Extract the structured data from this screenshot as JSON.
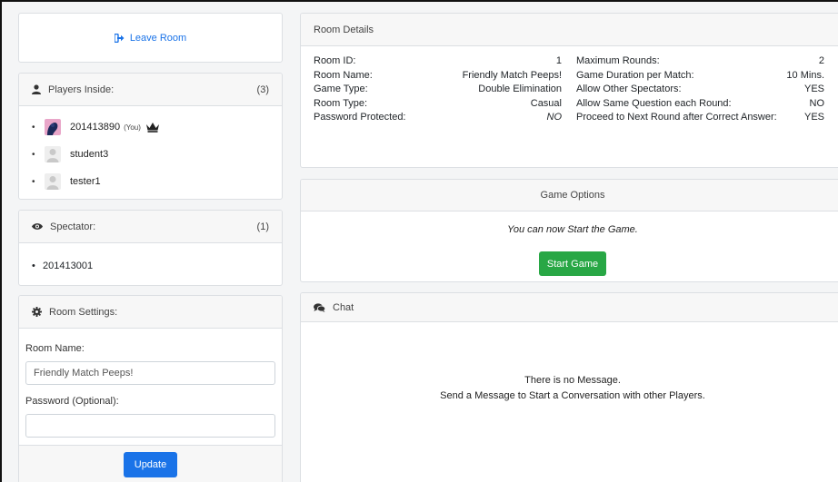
{
  "leave": {
    "label": "Leave Room"
  },
  "players": {
    "title": "Players Inside:",
    "count": "(3)",
    "items": [
      {
        "name": "201413890",
        "tag": "(You)"
      },
      {
        "name": "student3"
      },
      {
        "name": "tester1"
      }
    ]
  },
  "spectator": {
    "title": "Spectator:",
    "count": "(1)",
    "items": [
      {
        "name": "201413001"
      }
    ]
  },
  "settings": {
    "title": "Room Settings:",
    "room_name_label": "Room Name:",
    "room_name_value": "Friendly Match Peeps!",
    "password_label": "Password (Optional):",
    "password_value": "",
    "update_label": "Update"
  },
  "details": {
    "title": "Room Details",
    "left": [
      {
        "label": "Room ID:",
        "value": "1"
      },
      {
        "label": "Room Name:",
        "value": "Friendly Match Peeps!"
      },
      {
        "label": "Game Type:",
        "value": "Double Elimination"
      },
      {
        "label": "Room Type:",
        "value": "Casual"
      },
      {
        "label": "Password Protected:",
        "value": "NO"
      }
    ],
    "right": [
      {
        "label": "Maximum Rounds:",
        "value": "2"
      },
      {
        "label": "Game Duration per Match:",
        "value": "10 Mins."
      },
      {
        "label": "Allow Other Spectators:",
        "value": "YES"
      },
      {
        "label": "Allow Same Question each Round:",
        "value": "NO"
      },
      {
        "label": "Proceed to Next Round after Correct Answer:",
        "value": "YES"
      }
    ]
  },
  "options": {
    "title": "Game Options",
    "message": "You can now Start the Game.",
    "start_label": "Start Game"
  },
  "chat": {
    "title": "Chat",
    "empty_line1": "There is no Message.",
    "empty_line2": "Send a Message to Start a Conversation with other Players."
  },
  "icons": {
    "leave": "sign-out-icon",
    "players": "user-icon",
    "spectator": "eye-icon",
    "settings": "cog-icon",
    "chat": "comments-icon",
    "host": "crown-icon"
  },
  "colors": {
    "primary": "#1a73e8",
    "success": "#28a745"
  }
}
